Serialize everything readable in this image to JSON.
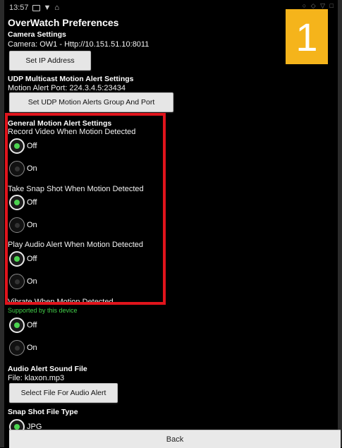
{
  "status_bar": {
    "time": "13:57",
    "icons": [
      "image-icon",
      "shield-icon",
      "home-icon"
    ],
    "right_icons": "○ ◇ ▽ □"
  },
  "app": {
    "title": "OverWatch Preferences"
  },
  "camera_settings": {
    "header": "Camera Settings",
    "info": "Camera: OW1 - Http://10.151.51.10:8011",
    "button": "Set IP Address"
  },
  "udp_settings": {
    "header": "UDP Multicast Motion Alert Settings",
    "info": "Motion Alert Port: 224.3.4.5:23434",
    "button": "Set UDP Motion Alerts Group And Port"
  },
  "motion_settings": {
    "header": "General Motion Alert Settings",
    "record_label": "Record Video When Motion Detected",
    "record_off": "Off",
    "record_on": "On",
    "snapshot_label": "Take Snap Shot When Motion Detected",
    "snapshot_off": "Off",
    "snapshot_on": "On",
    "audio_label": "Play Audio Alert When Motion Detected",
    "audio_off": "Off",
    "audio_on": "On",
    "vibrate_label": "Vibrate When Motion Detected",
    "vibrate_support": "Supported by this device",
    "vibrate_off": "Off",
    "vibrate_on": "On"
  },
  "audio_file": {
    "header": "Audio Alert Sound File",
    "info": "File: klaxon.mp3",
    "button": "Select File For Audio Alert"
  },
  "snapshot_type": {
    "header": "Snap Shot File Type",
    "option": "JPG"
  },
  "footer": {
    "back": "Back"
  },
  "annotation": {
    "badge": "1",
    "badge_color": "#f5b41b",
    "highlight_color": "#e0141c"
  }
}
